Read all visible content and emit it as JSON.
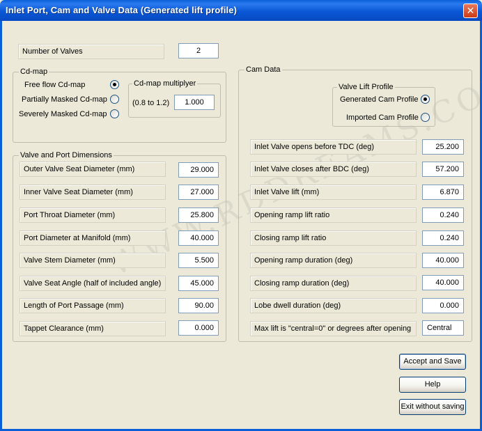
{
  "window": {
    "title": "Inlet Port, Cam and Valve Data (Generated lift profile)",
    "close_glyph": "✕"
  },
  "num_valves": {
    "label": "Number of Valves",
    "value": "2"
  },
  "cdmap": {
    "title": "Cd-map",
    "options": [
      {
        "label": "Free flow Cd-map",
        "checked": true
      },
      {
        "label": "Partially Masked Cd-map",
        "checked": false
      },
      {
        "label": "Severely Masked Cd-map",
        "checked": false
      }
    ],
    "multiplier": {
      "title": "Cd-map multiplyer",
      "range_label": "(0.8 to 1.2)",
      "value": "1.000"
    }
  },
  "valve_port": {
    "title": "Valve and Port Dimensions",
    "rows": [
      {
        "label": "Outer Valve Seat Diameter (mm)",
        "value": "29.000"
      },
      {
        "label": "Inner Valve Seat Diameter (mm)",
        "value": "27.000"
      },
      {
        "label": "Port Throat Diameter (mm)",
        "value": "25.800"
      },
      {
        "label": "Port Diameter at Manifold (mm)",
        "value": "40.000"
      },
      {
        "label": "Valve Stem Diameter (mm)",
        "value": "5.500"
      },
      {
        "label": "Valve Seat Angle (half of included angle)",
        "value": "45.000"
      },
      {
        "label": "Length of Port Passage (mm)",
        "value": "90.00"
      },
      {
        "label": "Tappet Clearance (mm)",
        "value": "0.000"
      }
    ]
  },
  "cam": {
    "title": "Cam Data",
    "lift_profile": {
      "title": "Valve Lift Profile",
      "options": [
        {
          "label": "Generated Cam Profile",
          "checked": true
        },
        {
          "label": "Imported Cam Profile",
          "checked": false
        }
      ]
    },
    "rows": [
      {
        "label": "Inlet Valve opens before TDC (deg)",
        "value": "25.200"
      },
      {
        "label": "Inlet Valve closes after BDC (deg)",
        "value": "57.200"
      },
      {
        "label": "Inlet Valve lift (mm)",
        "value": "6.870"
      },
      {
        "label": "Opening ramp lift ratio",
        "value": "0.240"
      },
      {
        "label": "Closing ramp lift ratio",
        "value": "0.240"
      },
      {
        "label": "Opening ramp duration (deg)",
        "value": "40.000"
      },
      {
        "label": "Closing ramp duration (deg)",
        "value": "40.000"
      },
      {
        "label": "Lobe dwell duration (deg)",
        "value": "0.000"
      },
      {
        "label": "Max lift is \"central=0\" or degrees after opening",
        "value": "Central"
      }
    ]
  },
  "buttons": {
    "accept": "Accept and Save",
    "help": "Help",
    "exit": "Exit without saving"
  },
  "watermark": "WWW.RDDREAMS.COM"
}
